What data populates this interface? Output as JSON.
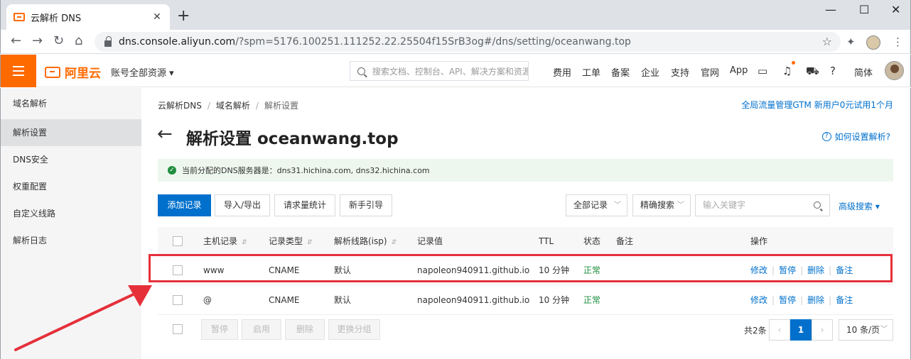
{
  "browser": {
    "tab_title": "云解析 DNS",
    "tab_close": "✕",
    "new_tab": "+",
    "url_host": "dns.console.aliyun.com",
    "url_rest": "/?spm=5176.100251.111252.22.25504f15SrB3og#/dns/setting/oceanwang.top"
  },
  "header": {
    "logo_text": "阿里云",
    "account_scope": "账号全部资源 ▾",
    "search_placeholder": "搜索文档、控制台、API、解决方案和资源",
    "nav": [
      "费用",
      "工单",
      "备案",
      "企业",
      "支持",
      "官网",
      "App"
    ],
    "lang": "简体"
  },
  "sidebar": {
    "items": [
      {
        "label": "域名解析"
      },
      {
        "label": "解析设置"
      },
      {
        "label": "DNS安全"
      },
      {
        "label": "权重配置"
      },
      {
        "label": "自定义线路"
      },
      {
        "label": "解析日志"
      }
    ]
  },
  "main": {
    "breadcrumb": [
      "云解析DNS",
      "域名解析",
      "解析设置"
    ],
    "promo": "全局流量管理GTM 新用户0元试用1个月",
    "title": "解析设置 oceanwang.top",
    "help": "如何设置解析?",
    "alert": "当前分配的DNS服务器是：dns31.hichina.com, dns32.hichina.com",
    "toolbar": {
      "add": "添加记录",
      "import_export": "导入/导出",
      "stats": "请求量统计",
      "guide": "新手引导",
      "filter": "全部记录",
      "search_mode": "精确搜索",
      "keyword_placeholder": "输入关键字",
      "advanced": "高级搜索 ▾"
    },
    "table": {
      "headers": [
        "主机记录",
        "记录类型",
        "解析线路(isp)",
        "记录值",
        "TTL",
        "状态",
        "备注",
        "操作"
      ],
      "rows": [
        {
          "host": "www",
          "type": "CNAME",
          "line": "默认",
          "value": "napoleon940911.github.io",
          "ttl": "10 分钟",
          "status": "正常",
          "note": ""
        },
        {
          "host": "@",
          "type": "CNAME",
          "line": "默认",
          "value": "napoleon940911.github.io",
          "ttl": "10 分钟",
          "status": "正常",
          "note": ""
        }
      ],
      "actions": [
        "修改",
        "暂停",
        "删除",
        "备注"
      ]
    },
    "footer": {
      "batch": [
        "暂停",
        "启用",
        "删除",
        "更换分组"
      ],
      "total": "共2条",
      "prev": "‹",
      "page": "1",
      "next": "›",
      "page_size": "10 条/页"
    }
  },
  "colors": {
    "brand": "#ff6a00",
    "primary": "#0070cc",
    "highlight": "#e5303a",
    "success": "#1e8e3e"
  }
}
